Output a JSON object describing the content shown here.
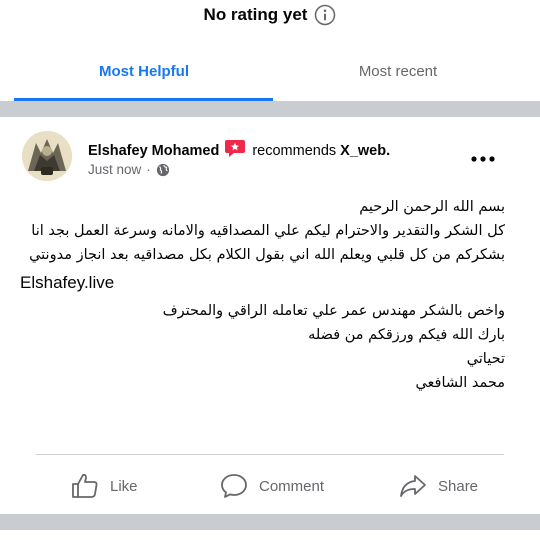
{
  "rating": {
    "text": "No rating yet",
    "icon": "info-icon"
  },
  "tabs": [
    {
      "label": "Most Helpful",
      "active": true
    },
    {
      "label": "Most recent",
      "active": false
    }
  ],
  "colors": {
    "accent": "#1877f2",
    "secondary_text": "#65676b",
    "divider": "#c9ccd1",
    "recommend_badge": "#f02849"
  },
  "review": {
    "author": "Elshafey Mohamed",
    "recommends_text": "recommends",
    "page": "X_web.",
    "time": "Just now",
    "separator": "·",
    "privacy_icon": "globe-icon",
    "body_lines": [
      "بسم الله الرحمن الرحيم",
      "كل الشكر والتقدير والاحترام ليكم علي المصداقيه والامانه وسرعة العمل بجد انا بشكركم من كل قلبي ويعلم الله اني بقول الكلام بكل مصداقيه بعد انجاز مدونتي",
      "Elshafey.live",
      "واخص بالشكر  مهندس عمر علي تعامله الراقي والمحترف",
      "بارك الله فيكم ورزقكم من فضله",
      "تحياتي",
      "محمد الشافعي"
    ]
  },
  "actions": {
    "like": "Like",
    "comment": "Comment",
    "share": "Share"
  }
}
